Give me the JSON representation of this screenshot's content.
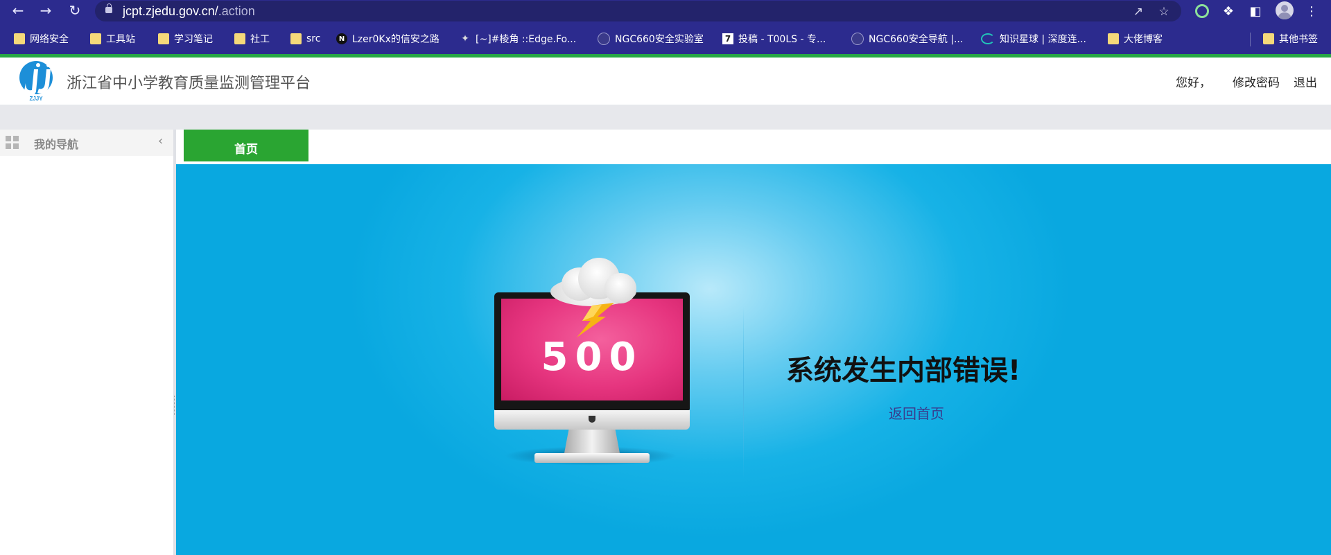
{
  "browser": {
    "url_host": "jcpt.zjedu.gov.cn/",
    "url_path": ".action",
    "bookmarks": [
      {
        "label": "网络安全",
        "icon": "folder-icon"
      },
      {
        "label": "工具站",
        "icon": "folder-icon"
      },
      {
        "label": "学习笔记",
        "icon": "folder-icon"
      },
      {
        "label": "社工",
        "icon": "folder-icon"
      },
      {
        "label": "src",
        "icon": "folder-icon"
      },
      {
        "label": "Lzer0Kx的信安之路",
        "icon": "site-n-icon"
      },
      {
        "label": "[~]#棱角 ::Edge.Fo...",
        "icon": "site-bird-icon"
      },
      {
        "label": "NGC660安全实验室",
        "icon": "site-globe-icon"
      },
      {
        "label": "投稿 - T00LS - 专...",
        "icon": "site-t00ls-icon"
      },
      {
        "label": "NGC660安全导航 |...",
        "icon": "site-globe-icon"
      },
      {
        "label": "知识星球 | 深度连...",
        "icon": "site-ring-icon"
      },
      {
        "label": "大佬博客",
        "icon": "folder-icon"
      }
    ],
    "other_bookmarks": "其他书签",
    "bookmark_n_glyph": "N",
    "bookmark_t00ls_glyph": "7"
  },
  "header": {
    "logo_text": "ZJJY",
    "site_title": "浙江省中小学教育质量监测管理平台",
    "greeting": "您好，",
    "change_password": "修改密码",
    "logout": "退出"
  },
  "sidebar": {
    "title": "我的导航"
  },
  "tabs": {
    "home": "首页"
  },
  "error": {
    "code": "500",
    "title": "系统发生内部错误!",
    "back_link": "返回首页"
  },
  "colors": {
    "browser_bg": "#2c2b8e",
    "accent_green": "#2aa532",
    "error_bg": "#09a8e0",
    "screen_pink": "#e6357f"
  }
}
